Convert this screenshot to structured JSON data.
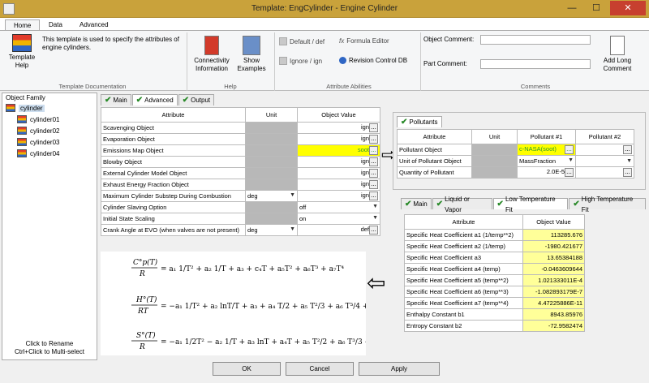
{
  "window": {
    "title": "Template: EngCylinder - Engine Cylinder",
    "minimize": "—",
    "maximize": "☐",
    "close": "✕"
  },
  "ribbon": {
    "tabs": [
      "Home",
      "Data",
      "Advanced"
    ],
    "template_desc": "This template is used to specify the attributes of engine cylinders.",
    "template_help": "Template\nHelp",
    "group_doc": "Template Documentation",
    "connectivity": "Connectivity\nInformation",
    "show_examples": "Show\nExamples",
    "group_help": "Help",
    "default_def": "Default / def",
    "ignore_ign": "Ignore / ign",
    "formula_editor": "Formula Editor",
    "revision_control": "Revision Control DB",
    "group_attr": "Attribute Abilities",
    "object_comment": "Object Comment:",
    "part_comment": "Part Comment:",
    "add_long": "Add Long\nComment",
    "group_comments": "Comments"
  },
  "left": {
    "title": "Object Family",
    "root": "cylinder",
    "children": [
      "cylinder01",
      "cylinder02",
      "cylinder03",
      "cylinder04"
    ],
    "hint1": "Click to Rename",
    "hint2": "Ctrl+Click to Multi-select"
  },
  "main": {
    "tabs": [
      "Main",
      "Advanced",
      "Output"
    ],
    "headers": [
      "Attribute",
      "Unit",
      "Object Value"
    ],
    "rows": [
      {
        "attr": "Scavenging Object",
        "unit": "",
        "value": "ign"
      },
      {
        "attr": "Evaporation Object",
        "unit": "",
        "value": "ign"
      },
      {
        "attr": "Emissions Map Object",
        "unit": "",
        "value": "soot"
      },
      {
        "attr": "Blowby Object",
        "unit": "",
        "value": "ign"
      },
      {
        "attr": "External Cylinder Model Object",
        "unit": "",
        "value": "ign"
      },
      {
        "attr": "Exhaust Energy Fraction Object",
        "unit": "",
        "value": "ign"
      },
      {
        "attr": "Maximum Cylinder Substep During Combustion",
        "unit": "deg",
        "value": "ign"
      },
      {
        "attr": "Cylinder Slaving Option",
        "unit": "",
        "value": "off"
      },
      {
        "attr": "Initial State Scaling",
        "unit": "",
        "value": "on"
      },
      {
        "attr": "Crank Angle at EVO (when valves are not present)",
        "unit": "deg",
        "value": "def"
      }
    ]
  },
  "pollutants": {
    "tab": "Pollutants",
    "headers": [
      "Attribute",
      "Unit",
      "Pollutant #1",
      "Pollutant #2"
    ],
    "rows": [
      {
        "attr": "Pollutant Object",
        "unit": "",
        "p1": "c-NASA(soot)",
        "p2": ""
      },
      {
        "attr": "Unit of Pollutant Object",
        "unit": "",
        "p1": "MassFraction",
        "p2": ""
      },
      {
        "attr": "Quantity of Pollutant",
        "unit": "",
        "p1": "2.0E-5",
        "p2": ""
      }
    ]
  },
  "nasa": {
    "tabs": [
      "Main",
      "Liquid or Vapor",
      "Low Temperature Fit",
      "High Temperature Fit"
    ],
    "headers": [
      "Attribute",
      "Object Value"
    ],
    "rows": [
      {
        "attr": "Specific Heat Coefficient a1 (1/temp**2)",
        "value": "113285.676"
      },
      {
        "attr": "Specific Heat Coefficient a2 (1/temp)",
        "value": "-1980.421677"
      },
      {
        "attr": "Specific Heat Coefficient a3",
        "value": "13.65384188"
      },
      {
        "attr": "Specific Heat Coefficient a4 (temp)",
        "value": "-0.0463609644"
      },
      {
        "attr": "Specific Heat Coefficient a5 (temp**2)",
        "value": "1.021333011E-4"
      },
      {
        "attr": "Specific Heat Coefficient a6 (temp**3)",
        "value": "-1.082893179E-7"
      },
      {
        "attr": "Specific Heat Coefficient a7 (temp**4)",
        "value": "4.47225886E-11"
      },
      {
        "attr": "Enthalpy Constant b1",
        "value": "8943.85976"
      },
      {
        "attr": "Entropy Constant b2",
        "value": "-72.9582474"
      }
    ]
  },
  "buttons": {
    "ok": "OK",
    "cancel": "Cancel",
    "apply": "Apply"
  },
  "colors": {
    "titlebar": "#c9a23b",
    "yellow": "#ffff00",
    "light_yellow": "#ffff99",
    "grey_cell": "#b8b8b8"
  }
}
